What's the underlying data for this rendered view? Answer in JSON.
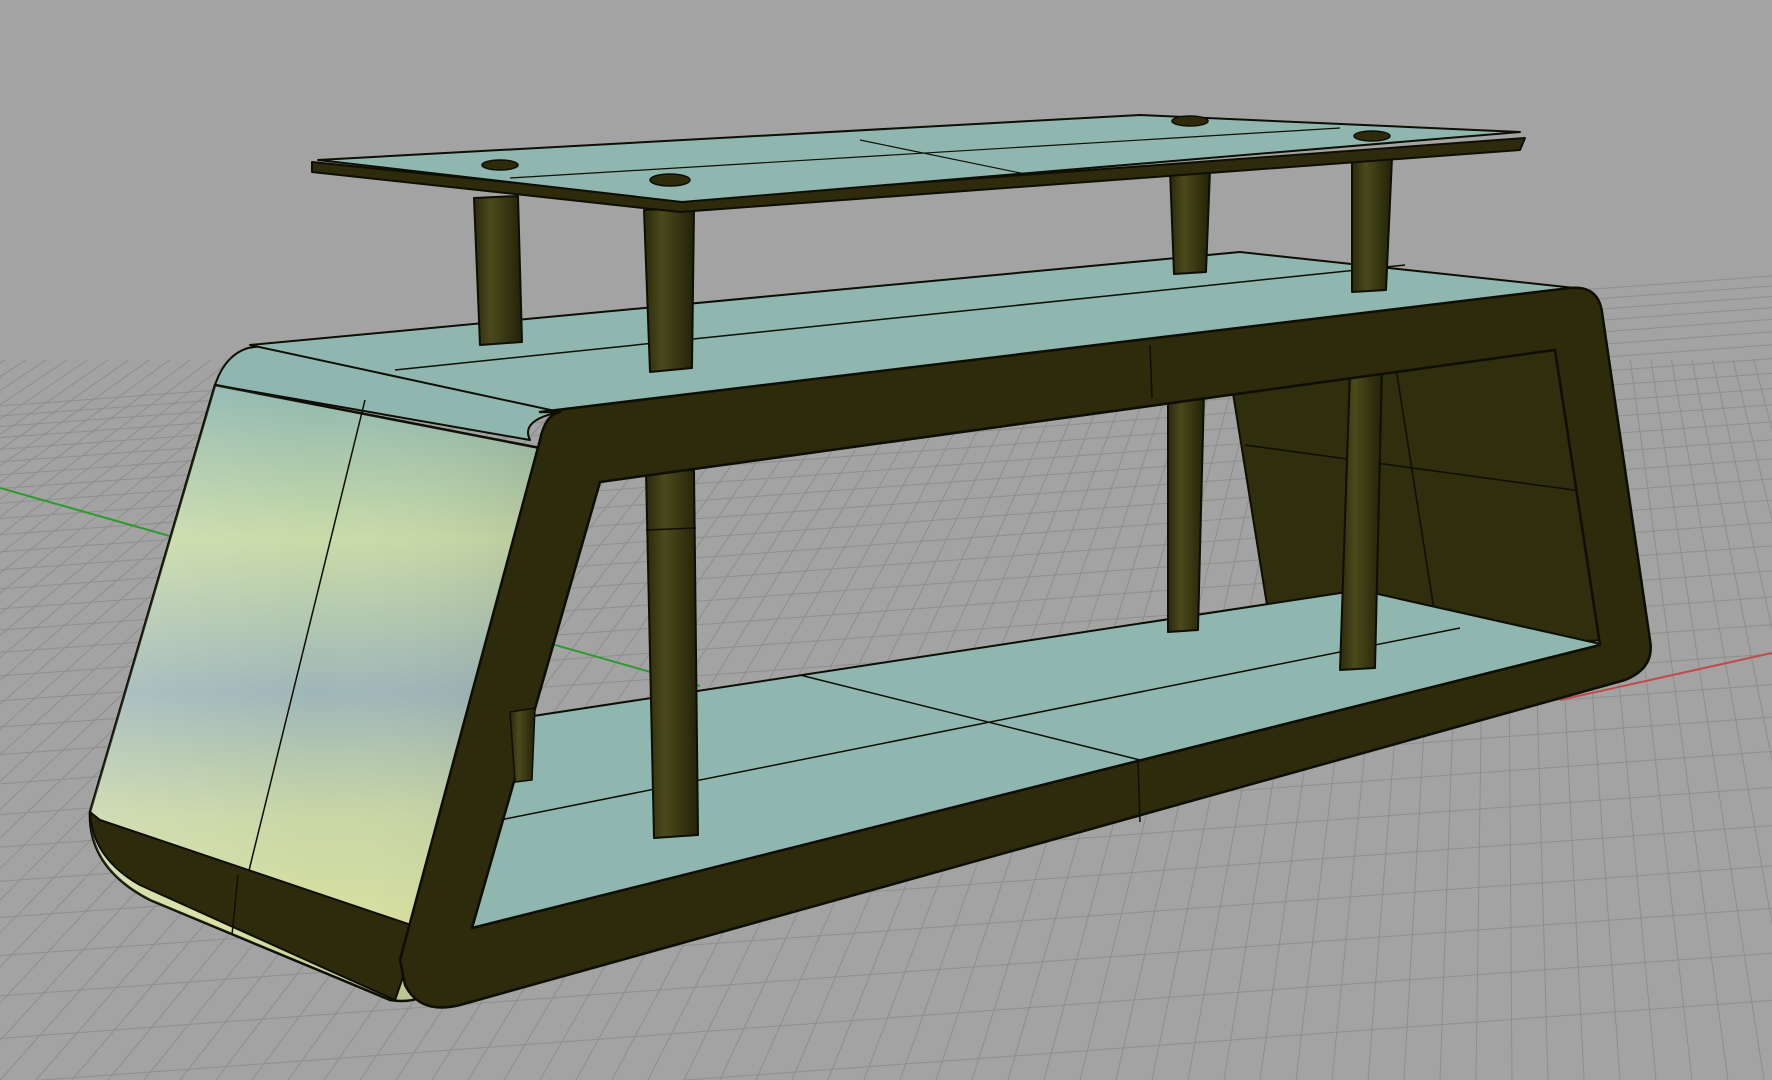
{
  "viewport": {
    "view": "perspective",
    "background_color": "#a3a3a3",
    "grid": true,
    "grid_color": "#8e8e8e",
    "x_axis_color": "#c44a4a",
    "y_axis_color": "#2e9a2e"
  },
  "model": {
    "object": "tv-stand",
    "shelf_color": "#8fb7b0",
    "frame_color": "#2d2b0c",
    "highlight_colors": [
      "#c9dba8",
      "#9fb6b8",
      "#d8e0a0"
    ],
    "edge_color": "#0e0e04",
    "legs": 4
  }
}
